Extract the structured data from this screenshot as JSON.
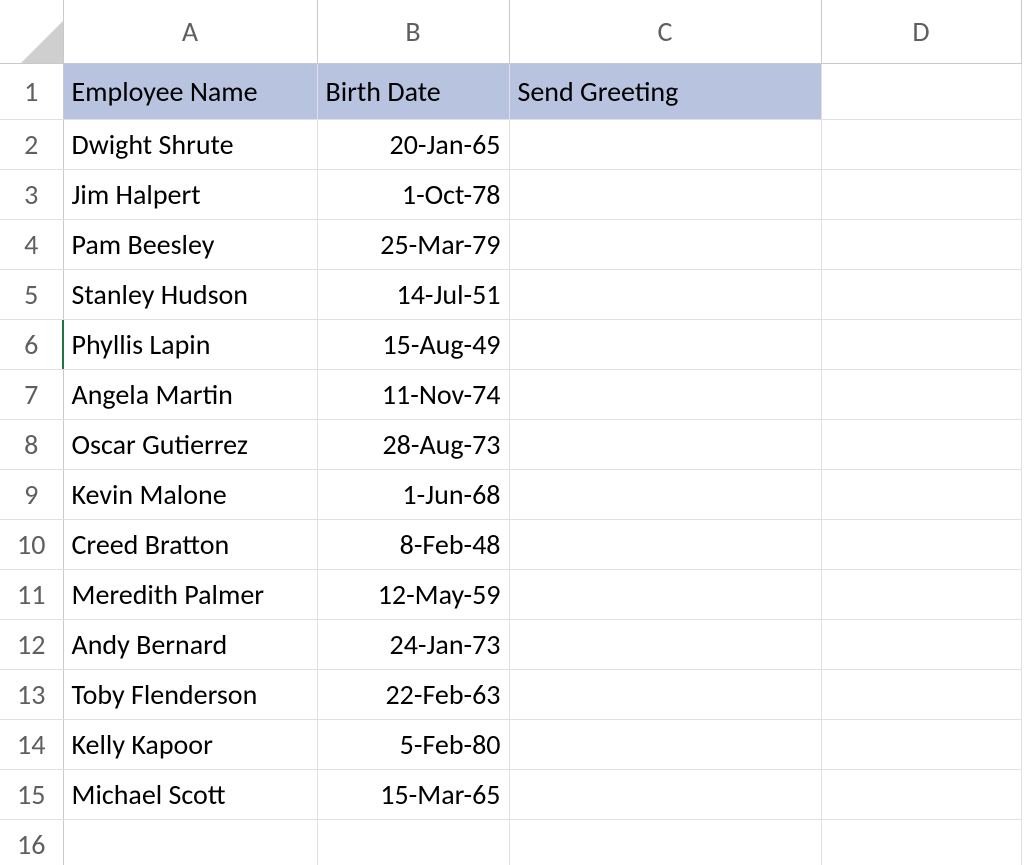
{
  "columns": [
    "A",
    "B",
    "C",
    "D"
  ],
  "row_numbers": [
    "1",
    "2",
    "3",
    "4",
    "5",
    "6",
    "7",
    "8",
    "9",
    "10",
    "11",
    "12",
    "13",
    "14",
    "15",
    "16"
  ],
  "active_row": "6",
  "header": {
    "A": "Employee Name",
    "B": "Birth Date",
    "C": "Send Greeting"
  },
  "rows": [
    {
      "name": "Dwight Shrute",
      "date": "20-Jan-65",
      "greeting": ""
    },
    {
      "name": "Jim Halpert",
      "date": "1-Oct-78",
      "greeting": ""
    },
    {
      "name": "Pam Beesley",
      "date": "25-Mar-79",
      "greeting": ""
    },
    {
      "name": "Stanley Hudson",
      "date": "14-Jul-51",
      "greeting": ""
    },
    {
      "name": "Phyllis Lapin",
      "date": "15-Aug-49",
      "greeting": ""
    },
    {
      "name": "Angela Martin",
      "date": "11-Nov-74",
      "greeting": ""
    },
    {
      "name": "Oscar Gutierrez",
      "date": "28-Aug-73",
      "greeting": ""
    },
    {
      "name": "Kevin Malone",
      "date": "1-Jun-68",
      "greeting": ""
    },
    {
      "name": "Creed Bratton",
      "date": "8-Feb-48",
      "greeting": ""
    },
    {
      "name": "Meredith Palmer",
      "date": "12-May-59",
      "greeting": ""
    },
    {
      "name": "Andy Bernard",
      "date": "24-Jan-73",
      "greeting": ""
    },
    {
      "name": "Toby Flenderson",
      "date": "22-Feb-63",
      "greeting": ""
    },
    {
      "name": "Kelly Kapoor",
      "date": "5-Feb-80",
      "greeting": ""
    },
    {
      "name": "Michael Scott",
      "date": "15-Mar-65",
      "greeting": ""
    }
  ]
}
